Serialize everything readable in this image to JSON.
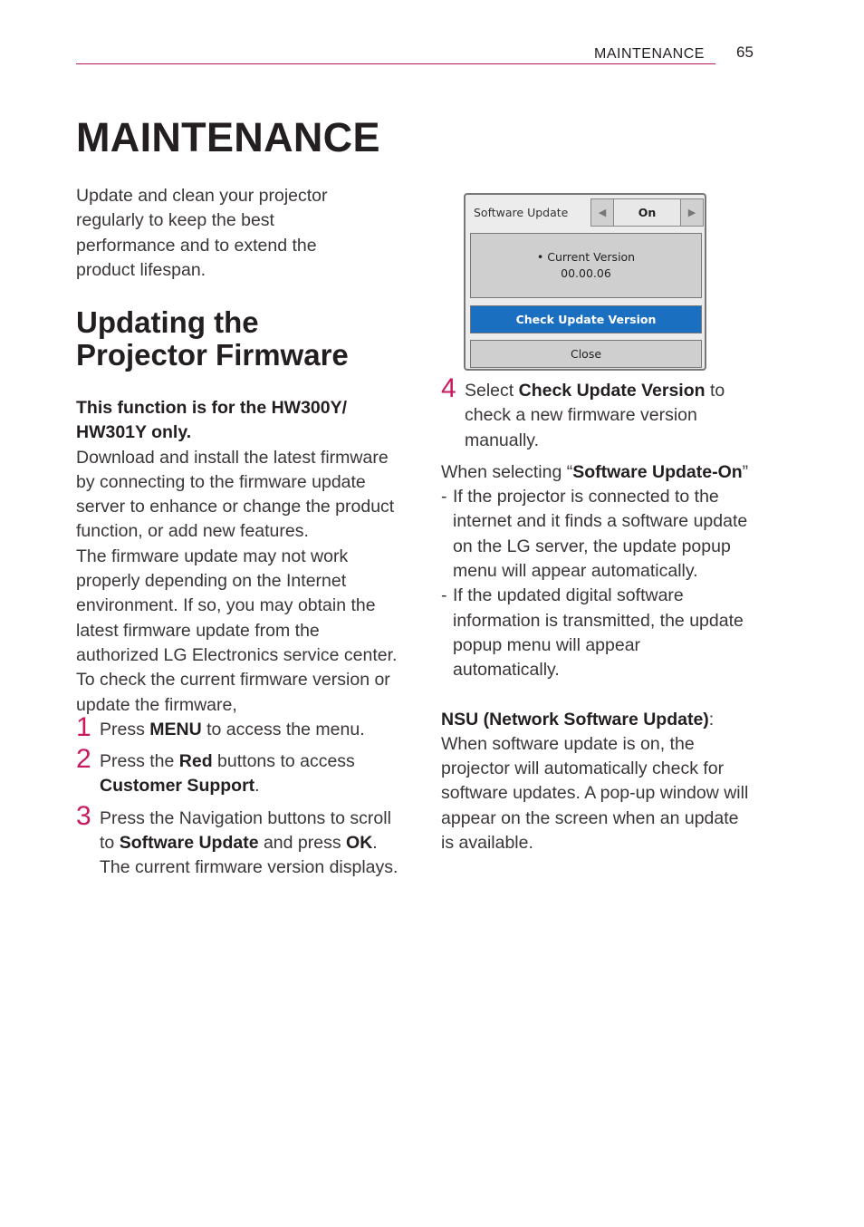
{
  "header": {
    "section": "MAINTENANCE",
    "page_number": "65",
    "accent_color": "#b5175f"
  },
  "title": "MAINTENANCE",
  "intro": "Update and clean your projector regularly to keep the best performance and to extend the product lifespan.",
  "section": {
    "title_line1": "Updating the",
    "title_line2": "Projector Firmware",
    "note": "This function is for the HW300Y/ HW301Y only.",
    "para1": "Download and install the latest firmware by connecting to the firmware update server to enhance or change the product function, or add new features.",
    "para2": "The firmware update may not work properly depending on the Internet environment. If so, you may obtain the latest firmware update from the authorized LG Electronics service center.",
    "para3": "To check the current firmware version or update the firmware,"
  },
  "steps": [
    {
      "num": "1",
      "pre": "Press ",
      "bold": "MENU",
      "post": " to access the menu."
    },
    {
      "num": "2",
      "pre": "Press the ",
      "bold": "Red",
      "mid": " buttons to access ",
      "bold2": "Customer Support",
      "post": "."
    },
    {
      "num": "3",
      "pre": "Press the Navigation buttons to scroll to ",
      "bold": "Software Update",
      "mid": " and press ",
      "bold2": "OK",
      "post": ".",
      "extra": "The current firmware version displays."
    },
    {
      "num": "4",
      "pre": "Select ",
      "bold": "Check Update Version",
      "post": " to check a new firmware version manually."
    }
  ],
  "osd": {
    "label": "Software Update",
    "value": "On",
    "left_arrow_icon": "triangle-left",
    "right_arrow_icon": "triangle-right",
    "info_label": "• Current Version",
    "version": "00.00.06",
    "primary_button": "Check Update Version",
    "secondary_button": "Close",
    "accent_color": "#1a6fc1"
  },
  "right": {
    "when_pre": "When selecting “",
    "when_bold": "Software Update-On",
    "when_post": "”",
    "bullets": [
      "If the projector is connected to the internet and it finds a software update on the LG server, the update popup menu will appear automatically.",
      "If the updated digital software information is transmitted, the update popup menu will appear automatically."
    ],
    "nsu_title": "NSU (Network Software Update)",
    "nsu_colon": ":",
    "nsu_text": "When software update is on, the projector will automatically check for software updates. A pop-up window will appear on the screen when an update is available."
  }
}
